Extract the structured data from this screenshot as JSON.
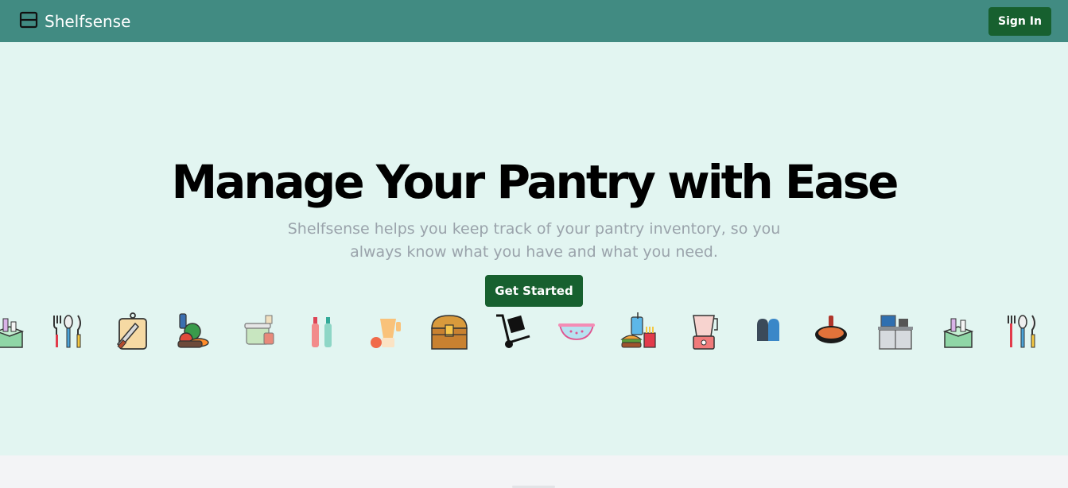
{
  "nav": {
    "brand": "Shelfsense",
    "brand_icon": "shelf-icon",
    "signin_label": "Sign In",
    "bg_color": "#418b82"
  },
  "hero": {
    "title": "Manage Your Pantry with Ease",
    "subtitle": "Shelfsense helps you keep track of your pantry inventory, so you always know what you have and what you need.",
    "cta_label": "Get Started",
    "bg_color": "#e2f5f1",
    "button_color": "#17602f"
  },
  "icons": [
    "grocery-box-icon",
    "utensils-icon",
    "cutting-board-knife-icon",
    "vegetables-icon",
    "cooking-pot-icon",
    "bottles-icon",
    "blender-icon",
    "treasure-chest-icon",
    "hand-truck-icon",
    "colander-icon",
    "fast-food-icon",
    "blender-icon",
    "oven-mitts-icon",
    "frying-pan-icon",
    "kitchen-counter-icon",
    "grocery-box-icon",
    "utensils-icon"
  ]
}
